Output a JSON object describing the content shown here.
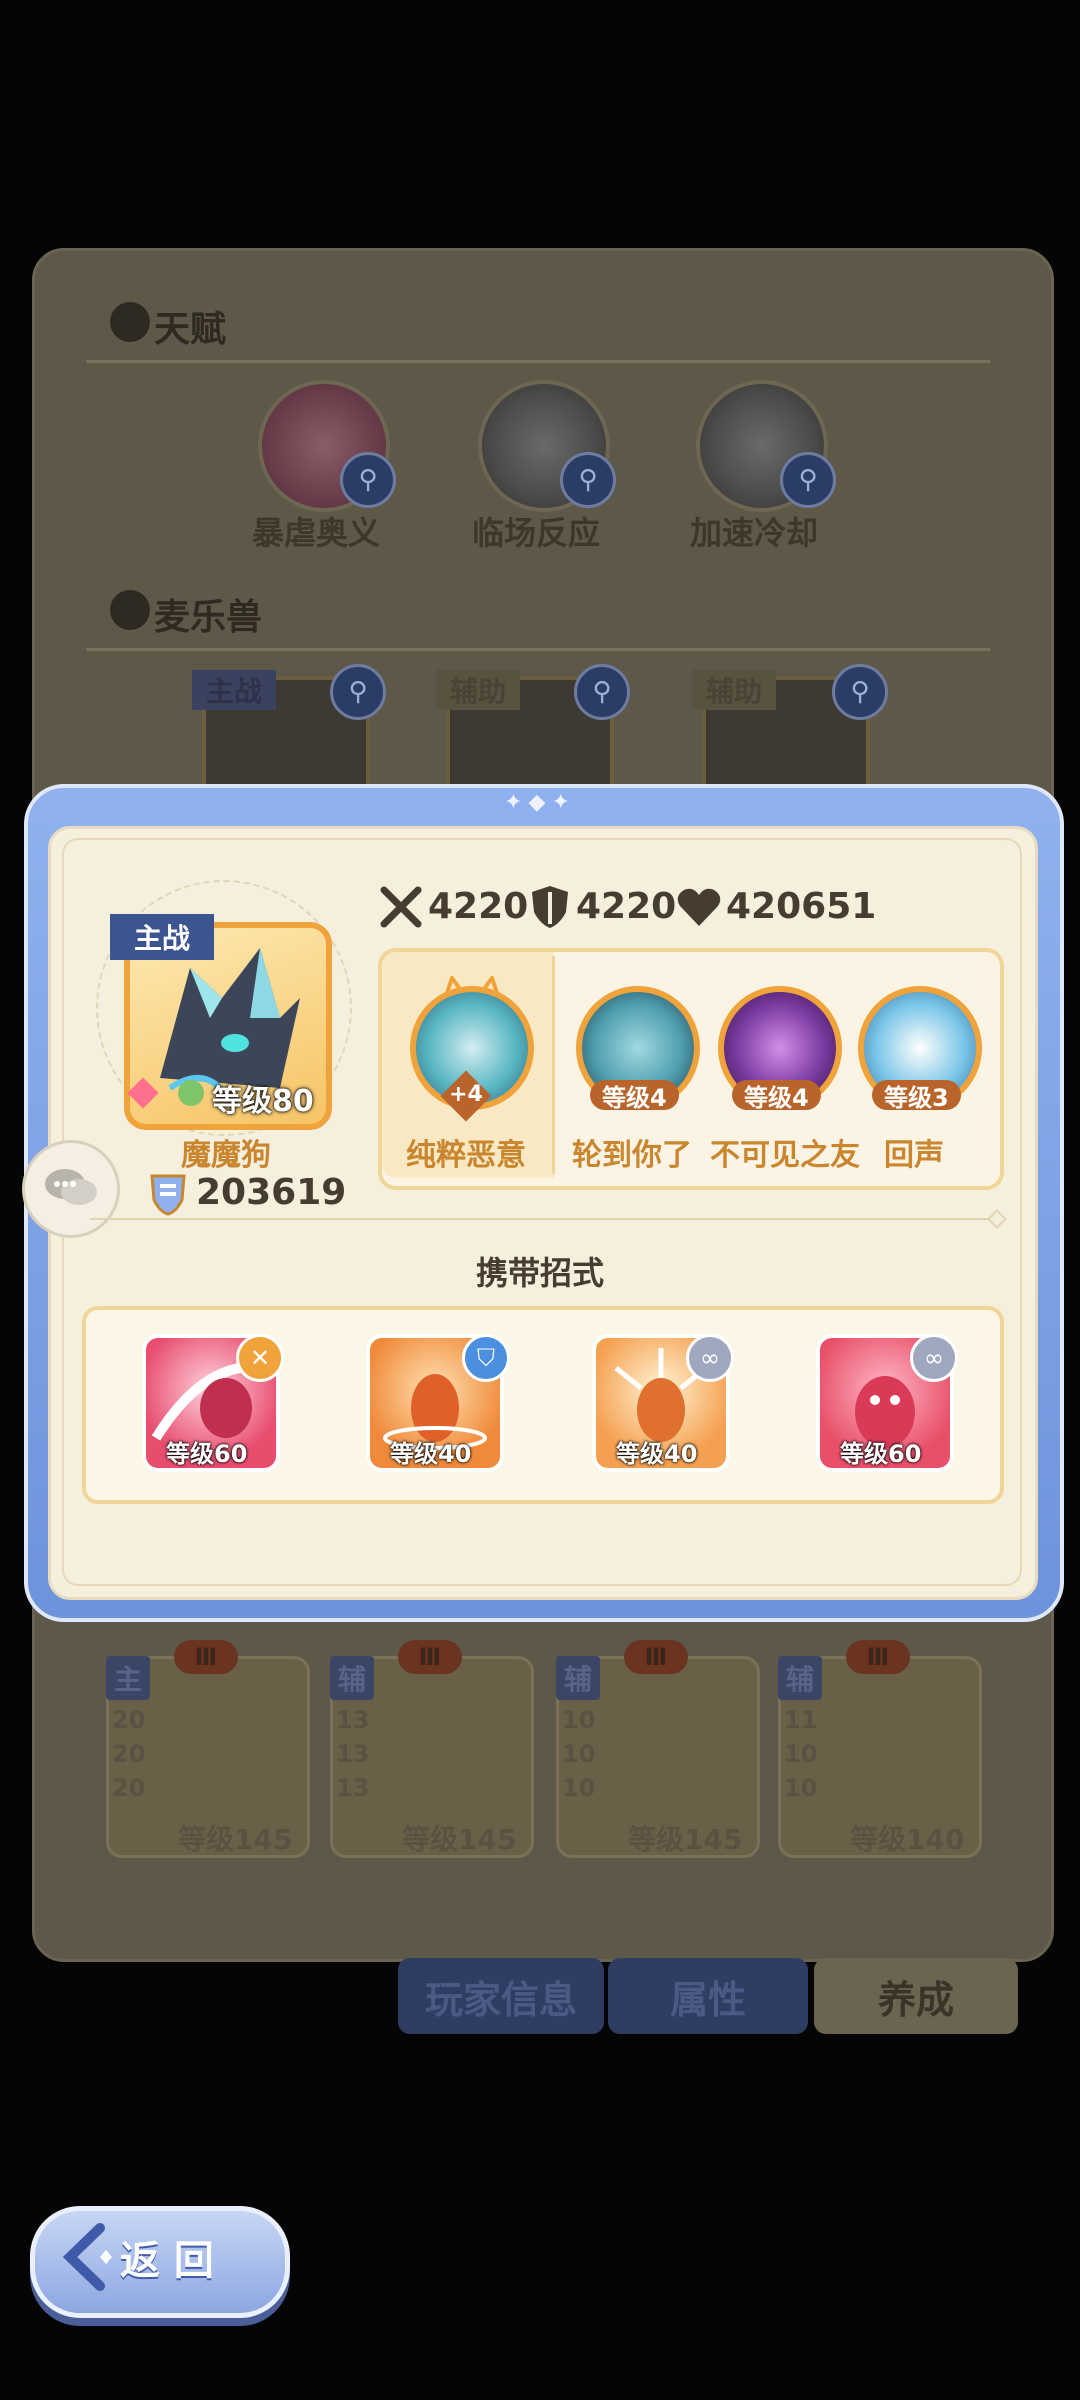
{
  "background": {
    "header_line1": "",
    "header_right": "",
    "talent": {
      "title": "天赋",
      "items": [
        {
          "label": "暴虐奥义",
          "icon": "ornate-sigil-icon"
        },
        {
          "label": "临场反应",
          "icon": "crystal-triangle-icon"
        },
        {
          "label": "加速冷却",
          "icon": "hourglass-coil-icon"
        }
      ]
    },
    "pets": {
      "title": "麦乐兽",
      "cards": [
        {
          "tag": "主战"
        },
        {
          "tag": "辅助"
        },
        {
          "tag": "辅助"
        }
      ]
    },
    "lower_cards": [
      {
        "tag": "主",
        "roman": "Ⅲ",
        "stats": [
          "20",
          "20",
          "20"
        ],
        "level": "等级145"
      },
      {
        "tag": "辅",
        "roman": "Ⅲ",
        "stats": [
          "13",
          "13",
          "13"
        ],
        "level": "等级145"
      },
      {
        "tag": "辅",
        "roman": "Ⅲ",
        "stats": [
          "10",
          "10",
          "10"
        ],
        "level": "等级145"
      },
      {
        "tag": "辅",
        "roman": "Ⅲ",
        "stats": [
          "11",
          "10",
          "10"
        ],
        "level": "等级140"
      }
    ],
    "tabs": [
      {
        "label": "玩家信息",
        "active": false
      },
      {
        "label": "属性",
        "active": false
      },
      {
        "label": "养成",
        "active": true
      }
    ]
  },
  "modal": {
    "stats": {
      "attack": "4220",
      "defense": "4220",
      "hp": "420651"
    },
    "pet": {
      "role_tag": "主战",
      "level": "等级80",
      "name": "魔魔狗",
      "power": "203619"
    },
    "skills": [
      {
        "name": "纯粹恶意",
        "badge": "+4",
        "color": "#59b6c4"
      },
      {
        "name": "轮到你了",
        "level": "等级4",
        "color": "#4e9fb0"
      },
      {
        "name": "不可见之友",
        "level": "等级4",
        "color": "#7a3aa0"
      },
      {
        "name": "回声",
        "level": "等级3",
        "color": "#7cc7e8"
      }
    ],
    "moves_title": "携带招式",
    "moves": [
      {
        "level": "等级60",
        "badge_icon": "cross-swords-icon",
        "badge_color": "#f0a23b",
        "bg": "#e84d6e"
      },
      {
        "level": "等级40",
        "badge_icon": "shield-icon",
        "badge_color": "#4a8fe0",
        "bg": "#f08a3a"
      },
      {
        "level": "等级40",
        "badge_icon": "link-icon",
        "badge_color": "#a0a8c0",
        "bg": "#f5a050"
      },
      {
        "level": "等级60",
        "badge_icon": "link-icon",
        "badge_color": "#a0a8c0",
        "bg": "#e8506a"
      }
    ]
  },
  "back_button": {
    "label": "返 回"
  },
  "colors": {
    "accent_blue": "#8fb1ef",
    "accent_orange": "#f0a23b",
    "skill_text": "#c9862e"
  }
}
